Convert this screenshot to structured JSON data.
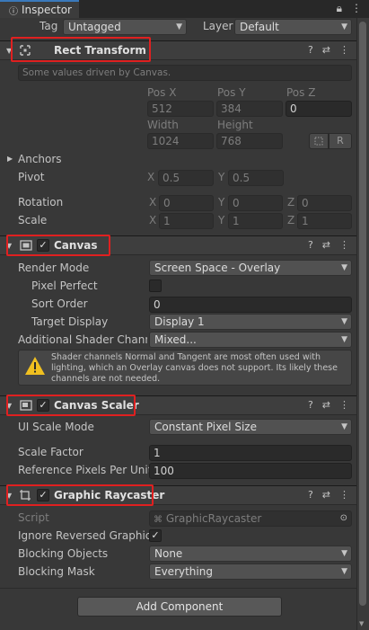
{
  "tab": {
    "title": "Inspector"
  },
  "object": {
    "tag_label": "Tag",
    "tag_value": "Untagged",
    "layer_label": "Layer",
    "layer_value": "Default"
  },
  "rect_transform": {
    "title": "Rect Transform",
    "info": "Some values driven by Canvas.",
    "pos_x_label": "Pos X",
    "pos_y_label": "Pos Y",
    "pos_z_label": "Pos Z",
    "pos_x": "512",
    "pos_y": "384",
    "pos_z": "0",
    "width_label": "Width",
    "height_label": "Height",
    "width": "1024",
    "height": "768",
    "r_button": "R",
    "anchors_label": "Anchors",
    "pivot_label": "Pivot",
    "pivot_x_label": "X",
    "pivot_x": "0.5",
    "pivot_y_label": "Y",
    "pivot_y": "0.5",
    "rotation_label": "Rotation",
    "rot_x_label": "X",
    "rot_x": "0",
    "rot_y_label": "Y",
    "rot_y": "0",
    "rot_z_label": "Z",
    "rot_z": "0",
    "scale_label": "Scale",
    "scale_x_label": "X",
    "scale_x": "1",
    "scale_y_label": "Y",
    "scale_y": "1",
    "scale_z_label": "Z",
    "scale_z": "1"
  },
  "canvas": {
    "title": "Canvas",
    "check": "✓",
    "render_mode_label": "Render Mode",
    "render_mode": "Screen Space - Overlay",
    "pixel_perfect_label": "Pixel Perfect",
    "sort_order_label": "Sort Order",
    "sort_order": "0",
    "target_display_label": "Target Display",
    "target_display": "Display 1",
    "shader_channels_label": "Additional Shader Channe",
    "shader_channels": "Mixed...",
    "help_text": "Shader channels Normal and Tangent are most often used with lighting, which an Overlay canvas does not support. Its likely these channels are not needed."
  },
  "canvas_scaler": {
    "title": "Canvas Scaler",
    "check": "✓",
    "ui_scale_mode_label": "UI Scale Mode",
    "ui_scale_mode": "Constant Pixel Size",
    "scale_factor_label": "Scale Factor",
    "scale_factor": "1",
    "ref_ppu_label": "Reference Pixels Per Unit",
    "ref_ppu": "100"
  },
  "graphic_raycaster": {
    "title": "Graphic Raycaster",
    "check": "✓",
    "script_label": "Script",
    "script_value": "GraphicRaycaster",
    "ignore_reversed_label": "Ignore Reversed Graphics",
    "ignore_reversed_check": "✓",
    "blocking_objects_label": "Blocking Objects",
    "blocking_objects": "None",
    "blocking_mask_label": "Blocking Mask",
    "blocking_mask": "Everything"
  },
  "add_component": "Add Component",
  "colors": {
    "highlight": "#e02020",
    "accent": "#3a79bb",
    "warning": "#f0c020"
  }
}
